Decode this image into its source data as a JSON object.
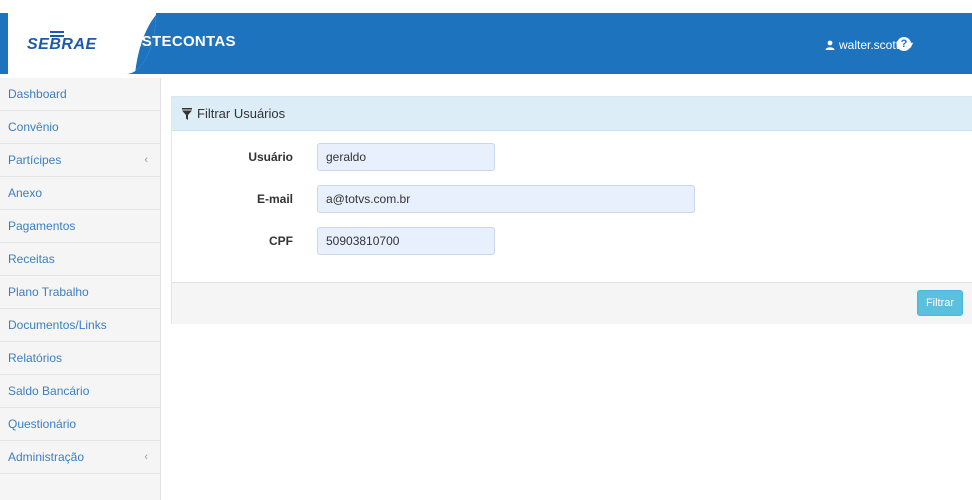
{
  "header": {
    "logo_text": "SEBRAE",
    "app_title": "PRESTECONTAS",
    "username": "walter.scott",
    "help_label": "?"
  },
  "sidebar": {
    "items": [
      {
        "label": "Dashboard",
        "chevron": ""
      },
      {
        "label": "Convênio",
        "chevron": ""
      },
      {
        "label": "Partícipes",
        "chevron": "‹"
      },
      {
        "label": "Anexo",
        "chevron": ""
      },
      {
        "label": "Pagamentos",
        "chevron": ""
      },
      {
        "label": "Receitas",
        "chevron": ""
      },
      {
        "label": "Plano Trabalho",
        "chevron": ""
      },
      {
        "label": "Documentos/Links",
        "chevron": ""
      },
      {
        "label": "Relatórios",
        "chevron": ""
      },
      {
        "label": "Saldo Bancário",
        "chevron": ""
      },
      {
        "label": "Questionário",
        "chevron": ""
      },
      {
        "label": "Administração",
        "chevron": "‹"
      }
    ]
  },
  "panel": {
    "title": "Filtrar Usuários",
    "fields": {
      "usuario": {
        "label": "Usuário",
        "value": "geraldo"
      },
      "email": {
        "label": "E-mail",
        "value": "a@totvs.com.br"
      },
      "cpf": {
        "label": "CPF",
        "value": "50903810700"
      }
    },
    "filter_button": "Filtrar"
  },
  "colors": {
    "brand_blue": "#1e73be",
    "link_blue": "#3a7fc3",
    "button_info": "#5bc0de"
  }
}
